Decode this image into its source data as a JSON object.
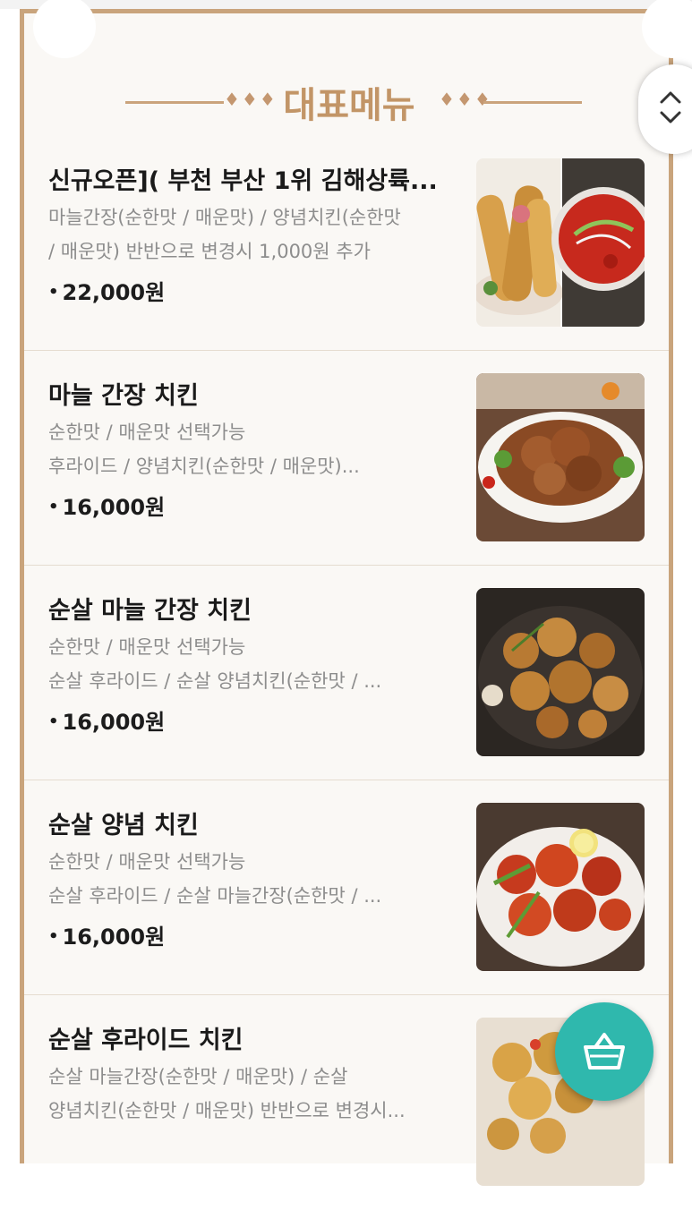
{
  "section_title": "대표메뉴",
  "colors": {
    "frame": "#c9a47c",
    "title": "#c29567",
    "cart_button": "#2fb8ad"
  },
  "icons": {
    "sort": "chevron-up-down-icon",
    "cart": "basket-icon"
  },
  "menu": [
    {
      "title": "신규오픈]( 부천 부산 1위 김해상륙...",
      "desc": [
        "마늘간장(순한맛 / 매운맛) / 양념치킨(순한맛",
        "/ 매운맛) 반반으로 변경시 1,000원 추가"
      ],
      "price": "22,000원",
      "image": "chicken-tenders-and-spicy-soup"
    },
    {
      "title": "마늘 간장 치킨",
      "desc": [
        "순한맛 / 매운맛 선택가능",
        "후라이드 / 양념치킨(순한맛 / 매운맛)..."
      ],
      "price": "16,000원",
      "image": "garlic-soy-chicken"
    },
    {
      "title": "순살 마늘 간장 치킨",
      "desc": [
        "순한맛 / 매운맛 선택가능",
        "순살 후라이드 / 순살 양념치킨(순한맛 / ..."
      ],
      "price": "16,000원",
      "image": "boneless-garlic-soy-chicken"
    },
    {
      "title": "순살 양념 치킨",
      "desc": [
        "순한맛 / 매운맛 선택가능",
        "순살 후라이드 / 순살 마늘간장(순한맛 / ..."
      ],
      "price": "16,000원",
      "image": "boneless-yangnyeom-chicken"
    },
    {
      "title": "순살 후라이드 치킨",
      "desc": [
        "순살 마늘간장(순한맛 / 매운맛) / 순살",
        "양념치킨(순한맛 / 매운맛) 반반으로 변경시..."
      ],
      "price": "",
      "image": "boneless-fried-chicken"
    }
  ]
}
